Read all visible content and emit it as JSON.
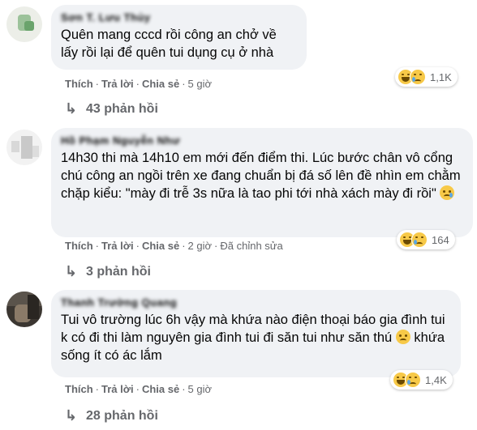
{
  "comments": [
    {
      "author": "Sơn T. Lưu Thủy",
      "text": "Quên mang cccd rồi công an chở về lấy rồi lại để quên tui dụng cụ ở nhà",
      "actions": {
        "like": "Thích",
        "reply": "Trả lời",
        "share": "Chia sẻ",
        "time": "5 giờ"
      },
      "reactions": {
        "icons": [
          "haha-icon",
          "sad-icon"
        ],
        "count": "1,1K"
      },
      "replies": "43 phản hồi"
    },
    {
      "author": "Hồ Phạm Nguyễn Như",
      "text": "14h30 thi mà 14h10 em mới đến điểm thi. Lúc bước chân vô cổng chú công an ngồi trên xe đang chuẩn bị đá số lên đề nhìn em chằm chặp kiểu: \"mày đi trễ 3s nữa là tao phi tới nhà xách mày đi rồi\"",
      "text_emoji": "crying-face-icon",
      "actions": {
        "like": "Thích",
        "reply": "Trả lời",
        "share": "Chia sẻ",
        "time": "2 giờ",
        "edited": "Đã chỉnh sửa"
      },
      "reactions": {
        "icons": [
          "haha-icon",
          "sad-icon"
        ],
        "count": "164"
      },
      "replies": "3 phản hồi"
    },
    {
      "author": "Thanh Trường Quang",
      "text_before": "Tui vô trường lúc 6h vậy mà khứa nào điện thoại báo gia đình tui k có đi thi làm nguyên gia đình tui đi săn tui như săn thú",
      "text_emoji": "disappointed-face-icon",
      "text_after": "khứa sống ít có ác lắm",
      "actions": {
        "like": "Thích",
        "reply": "Trả lời",
        "share": "Chia sẻ",
        "time": "5 giờ"
      },
      "reactions": {
        "icons": [
          "haha-icon",
          "sad-icon"
        ],
        "count": "1,4K"
      },
      "replies": "28 phản hồi"
    }
  ],
  "colors": {
    "bubble": "#f0f2f5",
    "meta": "#65676b",
    "text": "#050505",
    "emoji": "#f7c948"
  }
}
